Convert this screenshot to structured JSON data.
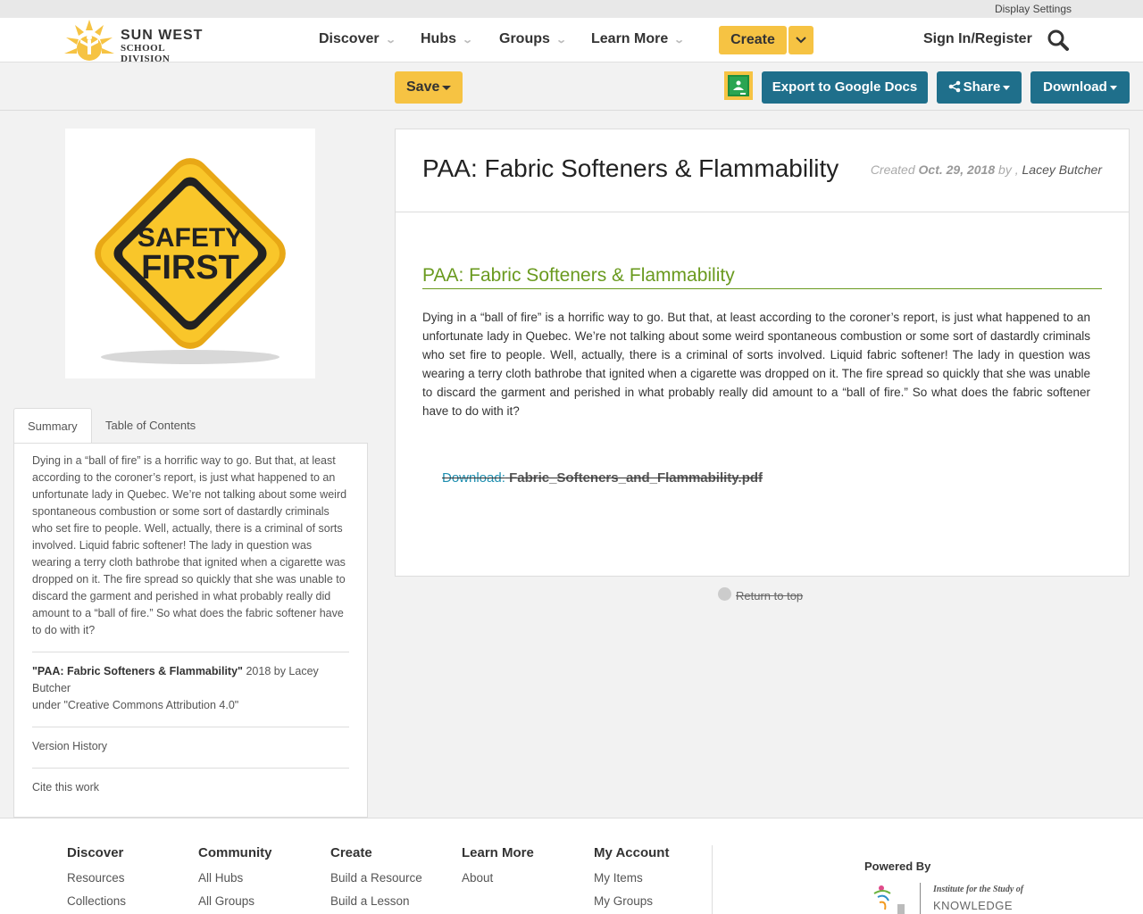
{
  "topbar": {
    "display_settings": "Display Settings"
  },
  "logo": {
    "line1": "SUN WEST",
    "line2": "SCHOOL DIVISION"
  },
  "nav": {
    "items": [
      {
        "label": "Discover"
      },
      {
        "label": "Hubs"
      },
      {
        "label": "Groups"
      },
      {
        "label": "Learn More"
      }
    ],
    "create_label": "Create",
    "signin_label": "Sign In/Register"
  },
  "toolbar": {
    "save_label": "Save",
    "export_label": "Export to Google Docs",
    "share_label": "Share",
    "download_label": "Download"
  },
  "cover": {
    "line1": "SAFETY",
    "line2": "FIRST"
  },
  "sidebar": {
    "tabs": [
      {
        "label": "Summary"
      },
      {
        "label": "Table of Contents"
      }
    ],
    "summary": "Dying in a “ball of fire” is a horrific way to go. But that, at least according to the coroner’s report, is just what happened to an unfortunate lady in Quebec. We’re not talking about some weird spontaneous combustion or some sort of dastardly criminals who set fire to people. Well, actually, there is a criminal of sorts involved. Liquid fabric softener! The lady in question was wearing a terry cloth bathrobe that ignited when a cigarette was dropped on it. The fire spread so quickly that she was unable to discard the garment and perished in what probably really did amount to a “ball of fire.” So what does the fabric softener have to do with it?",
    "license": {
      "title": "\"PAA: Fabric Softeners & Flammability\"",
      "year_by": " 2018 by Lacey Butcher",
      "under": "under \"Creative Commons Attribution 4.0\""
    },
    "version_history": "Version History",
    "cite": "Cite this work"
  },
  "main": {
    "title": "PAA: Fabric Softeners & Flammability",
    "created_prefix": "Created ",
    "created_date": "Oct. 29, 2018",
    "created_by": " by , ",
    "author": "Lacey Butcher",
    "section_title": "PAA: Fabric Softeners & Flammability",
    "body": "Dying in a “ball of fire” is a horrific way to go.  But that, at least according to the coroner’s report, is just what happened to an unfortunate lady in Quebec. We’re not talking about some weird spontaneous combustion or some sort of dastardly criminals who set fire to people.  Well, actually, there is a criminal of sorts involved.  Liquid fabric softener!  The lady in question was wearing a terry cloth bathrobe that ignited when a cigarette was dropped on it.  The fire spread so quickly that she was unable to discard the garment and perished in what probably really did amount to a “ball of fire.”  So what does the fabric softener have to do with it?",
    "download_label": "Download:",
    "download_file": "Fabric_Softeners_and_Flammability.pdf"
  },
  "return_top": "Return to top",
  "footer": {
    "columns": [
      {
        "head": "Discover",
        "links": [
          "Resources",
          "Collections"
        ]
      },
      {
        "head": "Community",
        "links": [
          "All Hubs",
          "All Groups"
        ]
      },
      {
        "head": "Create",
        "links": [
          "Build a Resource",
          "Build a Lesson"
        ]
      },
      {
        "head": "Learn More",
        "links": [
          "About"
        ]
      },
      {
        "head": "My Account",
        "links": [
          "My Items",
          "My Groups"
        ]
      }
    ],
    "powered_by": "Powered By",
    "isk_line1": "Institute for the Study of",
    "isk_line2": "KNOWLEDGE"
  },
  "colors": {
    "accent_yellow": "#f6c343",
    "button_blue": "#1f6f8b",
    "section_green": "#6a9a1f",
    "link_blue": "#1f8fb0"
  }
}
